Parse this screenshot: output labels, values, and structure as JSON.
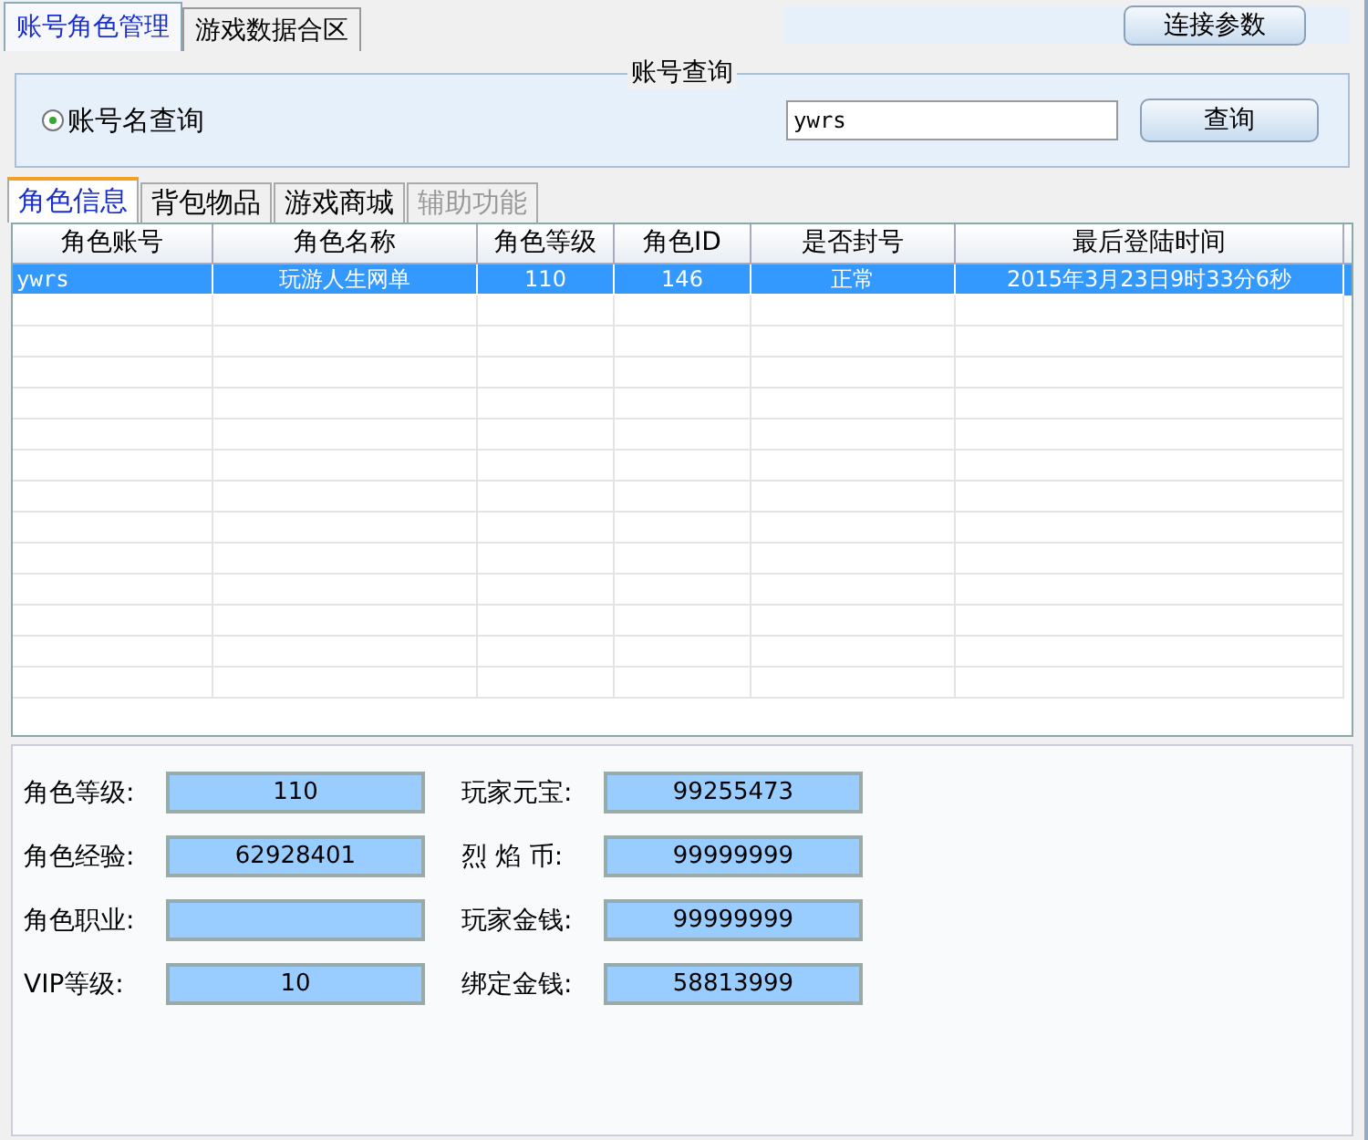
{
  "top_tabs": [
    {
      "label": "账号角色管理",
      "selected": true
    },
    {
      "label": "游戏数据合区",
      "selected": false
    }
  ],
  "connect_button": "连接参数",
  "query": {
    "title": "账号查询",
    "radio": {
      "label": "账号名查询",
      "selected": true
    },
    "value": "ywrs",
    "button": "查询"
  },
  "tabs": [
    {
      "label": "角色信息",
      "selected": true,
      "disabled": false
    },
    {
      "label": "背包物品",
      "selected": false,
      "disabled": false
    },
    {
      "label": "游戏商城",
      "selected": false,
      "disabled": false
    },
    {
      "label": "辅助功能",
      "selected": false,
      "disabled": true
    }
  ],
  "table": {
    "columns": [
      "角色账号",
      "角色名称",
      "角色等级",
      "角色ID",
      "是否封号",
      "最后登陆时间"
    ],
    "rows": [
      {
        "cells": [
          "ywrs",
          "玩游人生网单",
          "110",
          "146",
          "正常",
          "2015年3月23日9时33分6秒"
        ],
        "selected": true
      }
    ]
  },
  "fields": [
    {
      "label": "角色等级:",
      "value": "110"
    },
    {
      "label": "玩家元宝:",
      "value": "99255473"
    },
    {
      "label": "角色经验:",
      "value": "62928401"
    },
    {
      "label": "烈 焰 币:",
      "value": "99999999"
    },
    {
      "label": "角色职业:"
    },
    {
      "label": "玩家金钱:",
      "value": "99999999"
    },
    {
      "label": "VIP等级:",
      "value": "10"
    },
    {
      "label": "绑定金钱:",
      "value": "58813999"
    }
  ]
}
